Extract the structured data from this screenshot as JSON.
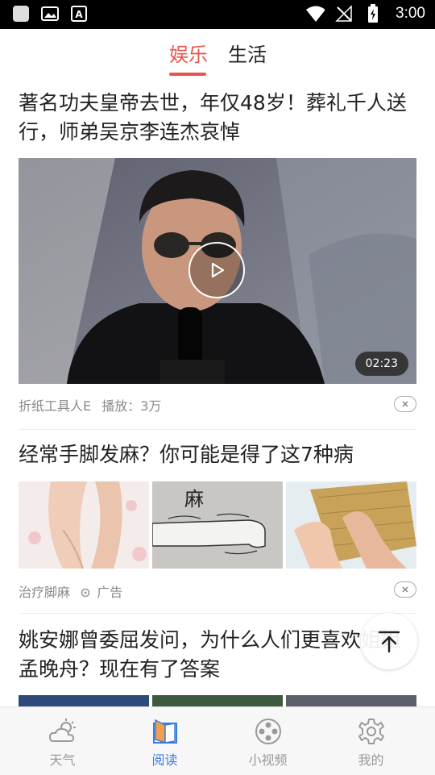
{
  "status_bar": {
    "time": "3:00"
  },
  "tabs": [
    {
      "label": "娱乐",
      "active": true
    },
    {
      "label": "生活",
      "active": false
    }
  ],
  "feed": [
    {
      "type": "video",
      "title": "著名功夫皇帝去世，年仅48岁！葬礼千人送行，师弟吴京李连杰哀悼",
      "duration": "02:23",
      "author": "折纸工具人E",
      "plays": "播放：3万"
    },
    {
      "type": "ad",
      "title": "经常手脚发麻？你可能是得了这7种病",
      "source": "治疗脚麻",
      "ad_label": "广告",
      "thumb_text": "麻"
    },
    {
      "type": "article",
      "title": "姚安娜曾委屈发问，为什么人们更喜欢姐姐孟晚舟？现在有了答案"
    }
  ],
  "bottom_nav": [
    {
      "label": "天气",
      "icon": "weather-icon",
      "active": false
    },
    {
      "label": "阅读",
      "icon": "book-icon",
      "active": true
    },
    {
      "label": "小视频",
      "icon": "film-reel-icon",
      "active": false
    },
    {
      "label": "我的",
      "icon": "gear-icon",
      "active": false
    }
  ],
  "colors": {
    "accent": "#e8554e",
    "nav_active": "#3b7be0"
  }
}
